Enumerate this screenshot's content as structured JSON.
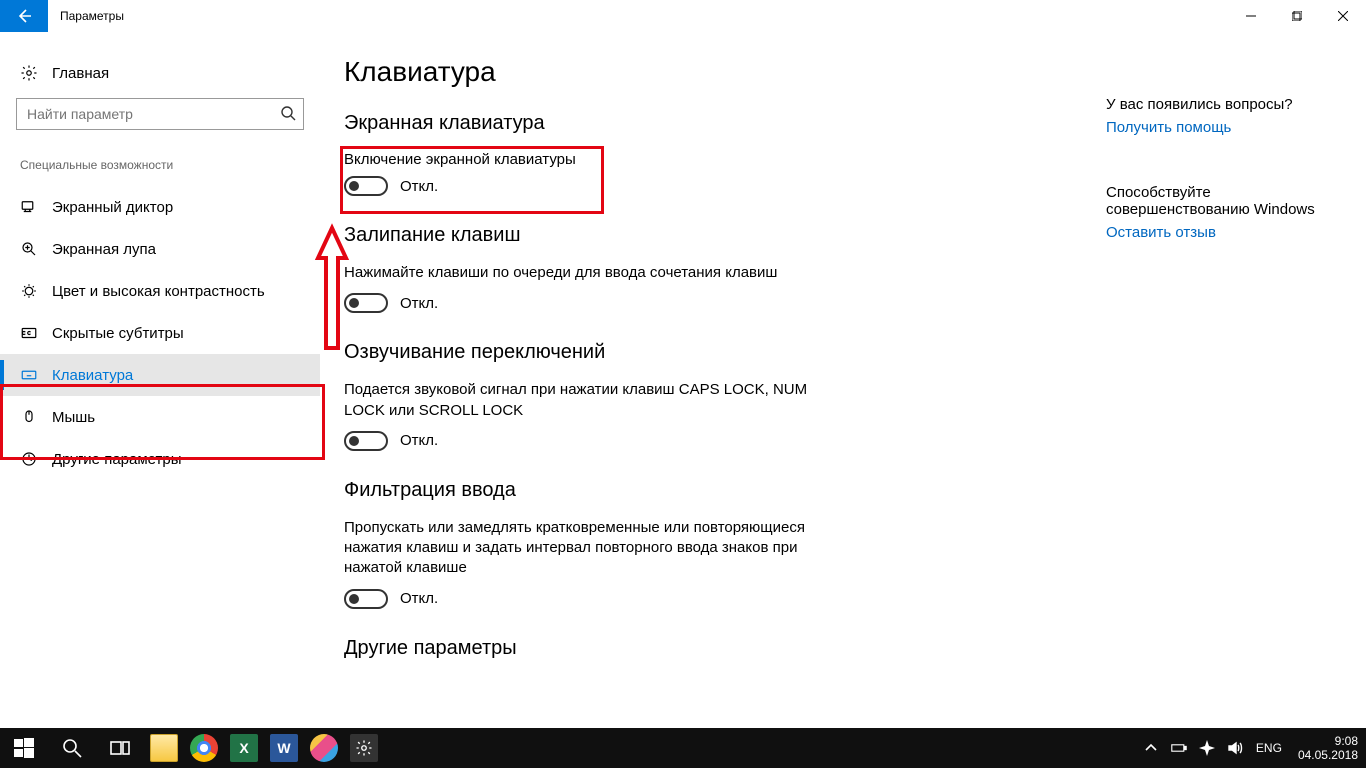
{
  "titlebar": {
    "title": "Параметры"
  },
  "sidebar": {
    "home": "Главная",
    "search_placeholder": "Найти параметр",
    "category": "Специальные возможности",
    "items": [
      {
        "label": "Экранный диктор"
      },
      {
        "label": "Экранная лупа"
      },
      {
        "label": "Цвет и высокая контрастность"
      },
      {
        "label": "Скрытые субтитры"
      },
      {
        "label": "Клавиатура"
      },
      {
        "label": "Мышь"
      },
      {
        "label": "Другие параметры"
      }
    ]
  },
  "page": {
    "title": "Клавиатура",
    "sec1": {
      "title": "Экранная клавиатура",
      "label": "Включение экранной клавиатуры",
      "state": "Откл."
    },
    "sec2": {
      "title": "Залипание клавиш",
      "desc": "Нажимайте клавиши по очереди для ввода сочетания клавиш",
      "state": "Откл."
    },
    "sec3": {
      "title": "Озвучивание переключений",
      "desc": "Подается звуковой сигнал при нажатии клавиш CAPS LOCK, NUM LOCK или SCROLL LOCK",
      "state": "Откл."
    },
    "sec4": {
      "title": "Фильтрация ввода",
      "desc": "Пропускать или замедлять кратковременные или повторяющиеся нажатия клавиш и задать интервал повторного ввода знаков при нажатой клавише",
      "state": "Откл."
    },
    "sec5": {
      "title": "Другие параметры"
    }
  },
  "right": {
    "q": "У вас появились вопросы?",
    "help": "Получить помощь",
    "improve": "Способствуйте совершенствованию Windows",
    "feedback": "Оставить отзыв"
  },
  "taskbar": {
    "lang": "ENG",
    "time": "9:08",
    "date": "04.05.2018"
  }
}
